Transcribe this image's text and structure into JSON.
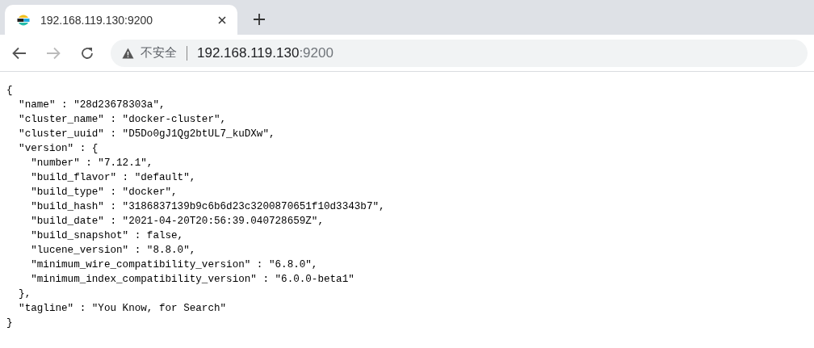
{
  "tabs": [
    {
      "title": "192.168.119.130:9200",
      "selected": true
    }
  ],
  "address_bar": {
    "security_label": "不安全",
    "host": "192.168.119.130",
    "port": ":9200"
  },
  "body_lines": [
    "{",
    "  \"name\" : \"28d23678303a\",",
    "  \"cluster_name\" : \"docker-cluster\",",
    "  \"cluster_uuid\" : \"D5Do0gJ1Qg2btUL7_kuDXw\",",
    "  \"version\" : {",
    "    \"number\" : \"7.12.1\",",
    "    \"build_flavor\" : \"default\",",
    "    \"build_type\" : \"docker\",",
    "    \"build_hash\" : \"3186837139b9c6b6d23c3200870651f10d3343b7\",",
    "    \"build_date\" : \"2021-04-20T20:56:39.040728659Z\",",
    "    \"build_snapshot\" : false,",
    "    \"lucene_version\" : \"8.8.0\",",
    "    \"minimum_wire_compatibility_version\" : \"6.8.0\",",
    "    \"minimum_index_compatibility_version\" : \"6.0.0-beta1\"",
    "  },",
    "  \"tagline\" : \"You Know, for Search\"",
    "}"
  ]
}
